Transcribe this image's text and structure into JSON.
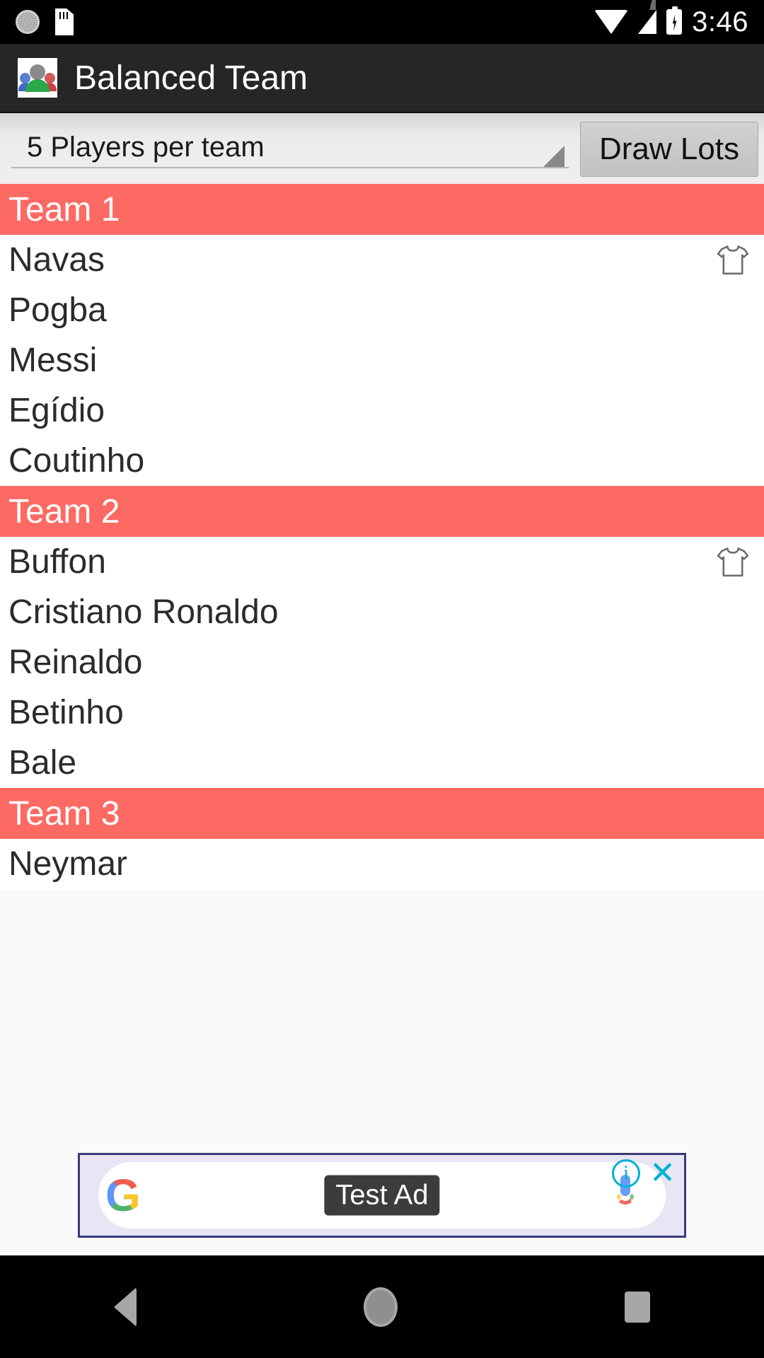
{
  "status_bar": {
    "time": "3:46",
    "icons_left": [
      "alarm-clock-icon",
      "sd-card-icon"
    ],
    "icons_right": [
      "wifi-icon",
      "signal-icon",
      "battery-charging-icon"
    ]
  },
  "app_bar": {
    "title": "Balanced Team",
    "icon": "group-people-icon",
    "background": "#262626"
  },
  "controls": {
    "spinner_value": "5 Players per team",
    "spinner_arrow": "dropdown-triangle-icon",
    "draw_button_label": "Draw Lots"
  },
  "colors": {
    "team_header_bg": "#FD6A64",
    "team_header_text": "#FFFFFF",
    "player_text": "#2B2B2B",
    "list_bg": "#FAFAFA"
  },
  "teams": [
    {
      "name": "Team 1",
      "players": [
        {
          "name": "Navas",
          "goalkeeper": true
        },
        {
          "name": "Pogba",
          "goalkeeper": false
        },
        {
          "name": "Messi",
          "goalkeeper": false
        },
        {
          "name": "Egídio",
          "goalkeeper": false
        },
        {
          "name": "Coutinho",
          "goalkeeper": false
        }
      ]
    },
    {
      "name": "Team 2",
      "players": [
        {
          "name": "Buffon",
          "goalkeeper": true
        },
        {
          "name": "Cristiano Ronaldo",
          "goalkeeper": false
        },
        {
          "name": "Reinaldo",
          "goalkeeper": false
        },
        {
          "name": "Betinho",
          "goalkeeper": false
        },
        {
          "name": "Bale",
          "goalkeeper": false
        }
      ]
    },
    {
      "name": "Team 3",
      "players": [
        {
          "name": "Neymar",
          "goalkeeper": false
        }
      ]
    }
  ],
  "ad": {
    "label": "Test Ad",
    "brand_icon": "google-g-logo",
    "mic_icon": "microphone-icon",
    "info_icon": "info-icon",
    "close_icon": "close-icon",
    "info_glyph": "i",
    "close_glyph": "✕"
  },
  "nav_bar": {
    "back": "back-triangle-icon",
    "home": "home-circle-icon",
    "recents": "recents-square-icon"
  }
}
